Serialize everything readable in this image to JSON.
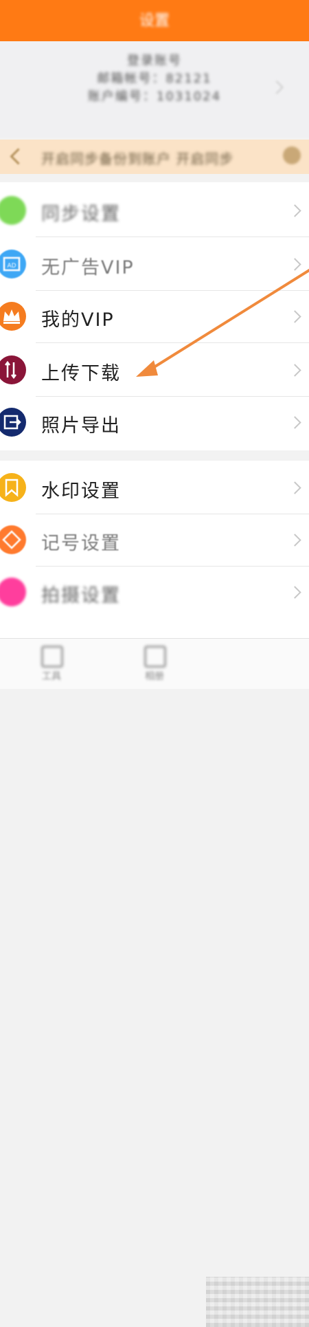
{
  "header": {
    "title": "设置"
  },
  "account": {
    "line1": "登录账号",
    "line2": "邮箱帐号：82121",
    "line3": "账户编号：1031024"
  },
  "banner": {
    "text": "开启同步备份到账户 开启同步"
  },
  "menu_group1": [
    {
      "label": "同步设置",
      "icon": "sync-icon",
      "color": "#7ed957"
    },
    {
      "label": "无广告VIP",
      "icon": "ad-icon",
      "color": "#3ea7f5"
    },
    {
      "label": "我的VIP",
      "icon": "crown-icon",
      "color": "#f57c20"
    },
    {
      "label": "上传下载",
      "icon": "upload-download-icon",
      "color": "#8a1538"
    },
    {
      "label": "照片导出",
      "icon": "export-icon",
      "color": "#142a6e"
    }
  ],
  "menu_group2": [
    {
      "label": "水印设置",
      "icon": "bookmark-icon",
      "color": "#f6b21a"
    },
    {
      "label": "记号设置",
      "icon": "mark-icon",
      "color": "#ff7a2e"
    },
    {
      "label": "拍摄设置",
      "icon": "camera-settings-icon",
      "color": "#ff3e9d"
    }
  ],
  "tabbar": [
    {
      "label": "工具"
    },
    {
      "label": "相册"
    }
  ],
  "colors": {
    "accent": "#ff7a14",
    "annotation_arrow": "#f08a3c"
  }
}
